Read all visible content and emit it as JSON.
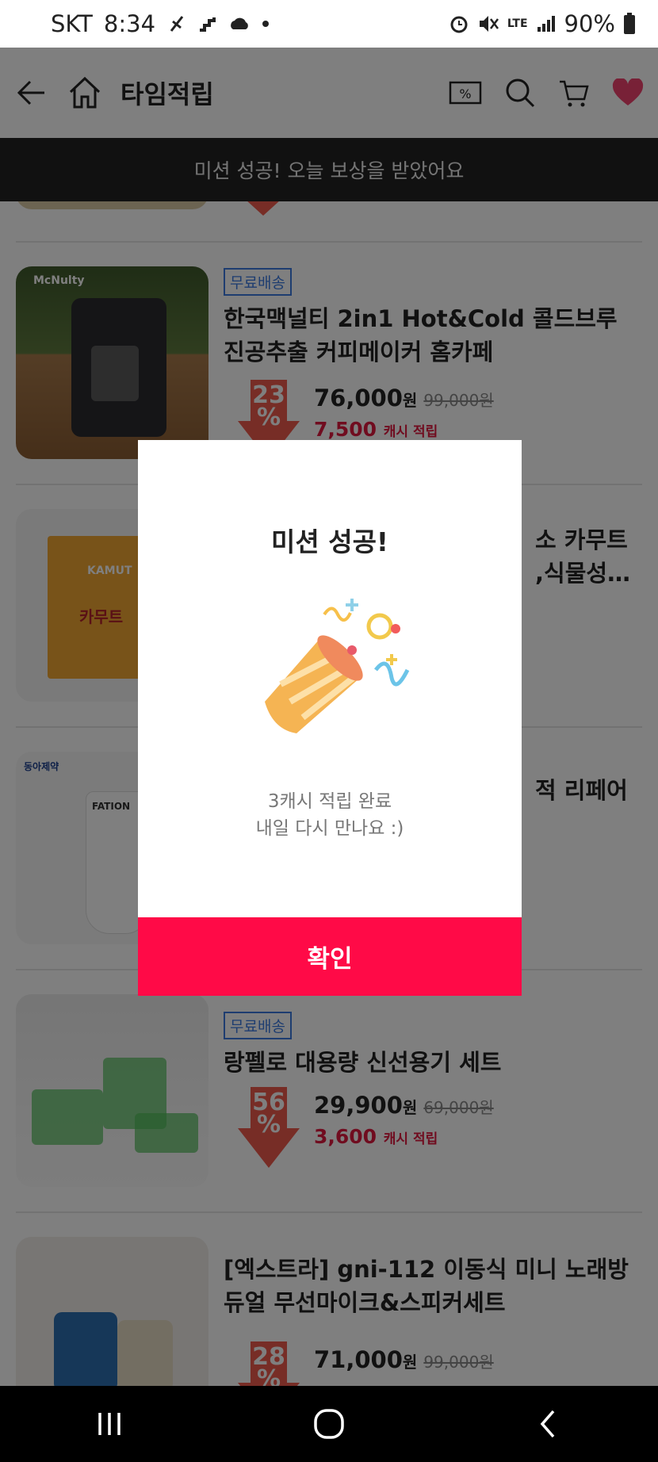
{
  "status_bar": {
    "carrier": "SKT",
    "time": "8:34",
    "network": "LTE",
    "battery": "90%"
  },
  "header": {
    "title": "타임적립"
  },
  "banner": {
    "text": "미션 성공! 오늘 보상을 받았어요"
  },
  "products": [
    {
      "badge": "무료배송",
      "name": "한국맥널티 2in1 Hot&Cold 콜드브루 진공추출 커피메이커 홈카페",
      "discount": "23",
      "price": "76,000",
      "unit": "원",
      "original": "99,000원",
      "cash": "7,500",
      "cash_label": "캐시 적립"
    },
    {
      "name": "소 카무트",
      "name2": ",식물성…"
    },
    {
      "name": "적 리페어"
    },
    {
      "badge": "무료배송",
      "name": "랑펠로 대용량 신선용기 세트",
      "discount": "56",
      "price": "29,900",
      "unit": "원",
      "original": "69,000원",
      "cash": "3,600",
      "cash_label": "캐시 적립"
    },
    {
      "name": "[엑스트라] gni-112 이동식 미니 노래방 듀얼 무선마이크&스피커세트",
      "discount": "28",
      "price": "71,000",
      "unit": "원",
      "original": "99,000원"
    }
  ],
  "thumb_text": {
    "brand1": "McNulty",
    "brand2": "KAMUT",
    "brand2_sub": "카무트",
    "brand3": "동아제약",
    "brand3_product": "FATION"
  },
  "modal": {
    "title": "미션 성공!",
    "line1": "3캐시 적립 완료",
    "line2": "내일 다시 만나요 :)",
    "confirm": "확인"
  },
  "pct_symbol": "%",
  "colors": {
    "accent": "#ff0a47",
    "cash": "#e0183f",
    "badge": "#3d7be0",
    "discount": "#ef5a4c"
  }
}
